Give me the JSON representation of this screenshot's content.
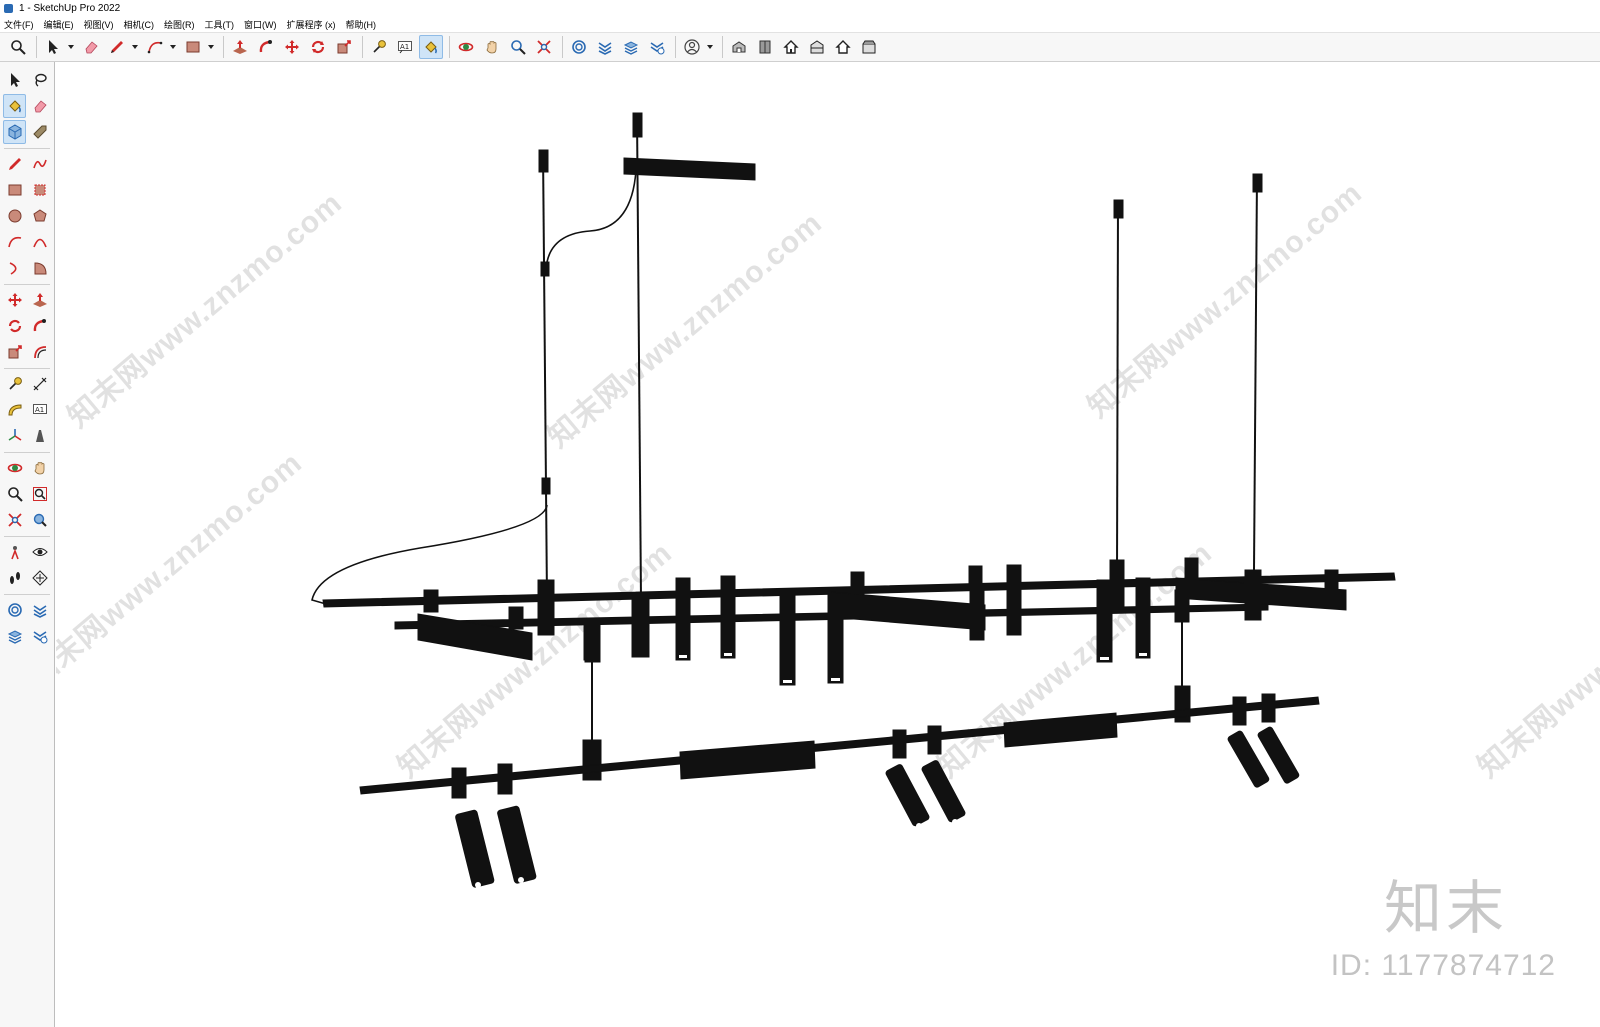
{
  "window": {
    "title": "1 - SketchUp Pro 2022"
  },
  "menu": [
    {
      "label": "文件(F)"
    },
    {
      "label": "编辑(E)"
    },
    {
      "label": "视图(V)"
    },
    {
      "label": "相机(C)"
    },
    {
      "label": "绘图(R)"
    },
    {
      "label": "工具(T)"
    },
    {
      "label": "窗口(W)"
    },
    {
      "label": "扩展程序 (x)"
    },
    {
      "label": "帮助(H)"
    }
  ],
  "toolbar": {
    "tools": [
      {
        "name": "zoom-icon"
      },
      {
        "name": "select-icon"
      },
      {
        "name": "eraser-icon"
      },
      {
        "name": "pencil-icon"
      },
      {
        "name": "arc-icon"
      },
      {
        "name": "rectangle-icon"
      },
      {
        "name": "push-pull-icon"
      },
      {
        "name": "follow-me-icon"
      },
      {
        "name": "move-icon"
      },
      {
        "name": "rotate-icon"
      },
      {
        "name": "scale-icon"
      },
      {
        "name": "tape-measure-icon"
      },
      {
        "name": "text-icon"
      },
      {
        "name": "paint-bucket-icon"
      },
      {
        "name": "orbit-icon"
      },
      {
        "name": "pan-icon"
      },
      {
        "name": "zoom-window-icon"
      },
      {
        "name": "zoom-extents-icon"
      },
      {
        "name": "warehouse-icon"
      },
      {
        "name": "extension-warehouse-icon"
      },
      {
        "name": "layout-icon"
      },
      {
        "name": "extension-manager-icon"
      },
      {
        "name": "account-icon"
      },
      {
        "name": "iso-view-icon"
      },
      {
        "name": "top-view-icon"
      },
      {
        "name": "front-view-icon"
      },
      {
        "name": "right-view-icon"
      },
      {
        "name": "back-view-icon"
      },
      {
        "name": "left-view-icon"
      }
    ],
    "text_tool_label": "A1"
  },
  "left_toolbar": {
    "text_tool_label": "A1"
  },
  "colors": {
    "accent_red": "#d12a2a",
    "accent_blue": "#2a6ab3",
    "model_black": "#111111"
  },
  "watermark": {
    "text": "知末网www.znzmo.com",
    "logo": "知末",
    "id_label": "ID: 1177874712"
  }
}
